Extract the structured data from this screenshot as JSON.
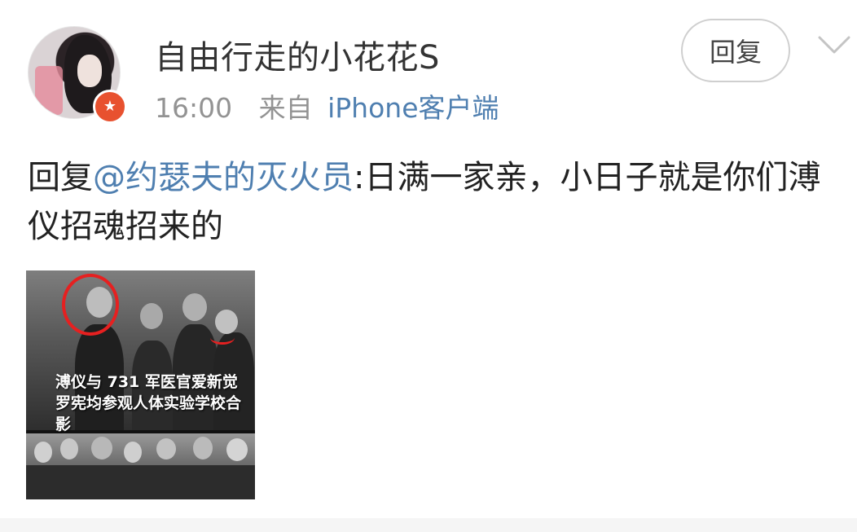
{
  "post": {
    "username": "自由行走的小花花S",
    "time": "16:00",
    "from_label": "来自",
    "client": "iPhone客户端",
    "reply_button": "回复",
    "badge_icon": "verified-star-icon",
    "content": {
      "prefix": "回复",
      "mention": "@约瑟夫的灭火员",
      "text": ":日满一家亲，小日子就是你们溥仪招魂招来的"
    },
    "image": {
      "caption": "溥仪与 731 军医官爱新觉罗宪均参观人体实验学校合影"
    }
  },
  "colors": {
    "link": "#4f7fb0",
    "badge": "#e8512f",
    "highlight": "#e62020"
  }
}
